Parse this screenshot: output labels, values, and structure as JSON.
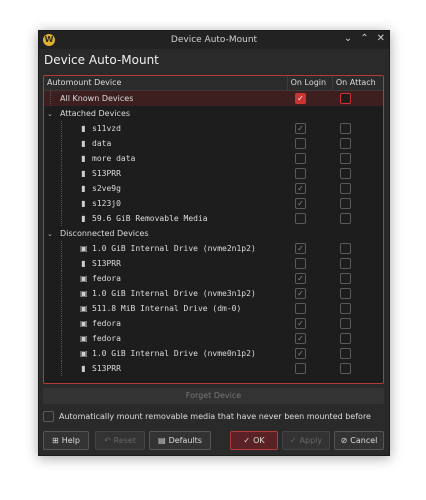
{
  "window": {
    "title": "Device Auto-Mount",
    "app_icon": "W",
    "controls": [
      "⌄",
      "⌃",
      "✕"
    ]
  },
  "heading": "Device Auto-Mount",
  "table": {
    "columns": [
      "Automount Device",
      "On Login",
      "On Attach"
    ],
    "rows": [
      {
        "label": "All Known Devices",
        "level": 0,
        "login": "checked",
        "attach": "unchecked",
        "selected": true
      },
      {
        "label": "Attached Devices",
        "level": 0,
        "group": true,
        "expanded": true
      },
      {
        "label": "s11vzd",
        "level": 1,
        "icon": "usb-drive-icon",
        "login": "checked-disabled",
        "attach": "unchecked"
      },
      {
        "label": "data",
        "level": 1,
        "icon": "usb-drive-icon",
        "login": "unchecked-disabled",
        "attach": "unchecked"
      },
      {
        "label": "more data",
        "level": 1,
        "icon": "usb-drive-icon",
        "login": "unchecked-disabled",
        "attach": "unchecked"
      },
      {
        "label": "S13PRR",
        "level": 1,
        "icon": "usb-drive-icon",
        "login": "unchecked-disabled",
        "attach": "unchecked"
      },
      {
        "label": "s2ve9g",
        "level": 1,
        "icon": "usb-drive-icon",
        "login": "checked-disabled",
        "attach": "unchecked"
      },
      {
        "label": "s123j0",
        "level": 1,
        "icon": "usb-drive-icon",
        "login": "checked-disabled",
        "attach": "unchecked"
      },
      {
        "label": "59.6 GiB Removable Media",
        "level": 1,
        "icon": "usb-drive-icon",
        "login": "unchecked-disabled",
        "attach": "unchecked"
      },
      {
        "label": "Disconnected Devices",
        "level": 0,
        "group": true,
        "expanded": true
      },
      {
        "label": "1.0 GiB Internal Drive (nvme2n1p2)",
        "level": 1,
        "icon": "hdd-icon",
        "login": "checked-disabled",
        "attach": "unchecked"
      },
      {
        "label": "S13PRR",
        "level": 1,
        "icon": "usb-drive-icon",
        "login": "unchecked-disabled",
        "attach": "unchecked"
      },
      {
        "label": "fedora",
        "level": 1,
        "icon": "hdd-icon",
        "login": "checked-disabled",
        "attach": "unchecked"
      },
      {
        "label": "1.0 GiB Internal Drive (nvme3n1p2)",
        "level": 1,
        "icon": "hdd-icon",
        "login": "checked-disabled",
        "attach": "unchecked"
      },
      {
        "label": "511.8 MiB Internal Drive (dm-0)",
        "level": 1,
        "icon": "hdd-icon",
        "login": "unchecked-disabled",
        "attach": "unchecked"
      },
      {
        "label": "fedora",
        "level": 1,
        "icon": "hdd-icon",
        "login": "checked-disabled",
        "attach": "unchecked"
      },
      {
        "label": "fedora",
        "level": 1,
        "icon": "hdd-icon",
        "login": "checked-disabled",
        "attach": "unchecked"
      },
      {
        "label": "1.0 GiB Internal Drive (nvme0n1p2)",
        "level": 1,
        "icon": "hdd-icon",
        "login": "checked-disabled",
        "attach": "unchecked"
      },
      {
        "label": "S13PRR",
        "level": 1,
        "icon": "usb-drive-icon",
        "login": "unchecked-disabled",
        "attach": "unchecked"
      }
    ]
  },
  "forget_button": "Forget Device",
  "auto_mount_label": "Automatically mount removable media that have never been mounted before",
  "buttons": {
    "help": "Help",
    "reset": "Reset",
    "defaults": "Defaults",
    "ok": "OK",
    "apply": "Apply",
    "cancel": "Cancel"
  },
  "colors": {
    "accent": "#c33333",
    "background": "#2a2a2a",
    "list_bg": "#1d1d1d"
  }
}
